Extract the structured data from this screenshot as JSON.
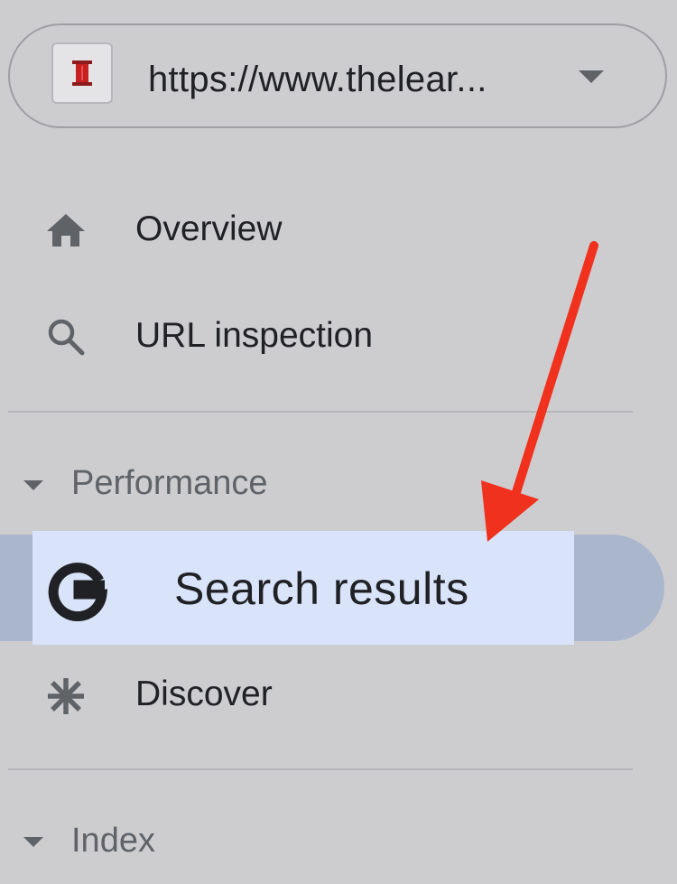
{
  "property_selector": {
    "url": "https://www.thelear...",
    "favicon": "red-spool-favicon",
    "dropdown_icon": "caret-down-icon"
  },
  "nav": {
    "overview": {
      "label": "Overview",
      "icon": "home-icon"
    },
    "url_inspection": {
      "label": "URL inspection",
      "icon": "search-icon"
    }
  },
  "sections": {
    "performance": {
      "label": "Performance",
      "items": {
        "search_results": {
          "label": "Search results",
          "icon": "google-g-icon",
          "active": true
        },
        "discover": {
          "label": "Discover",
          "icon": "asterisk-icon"
        }
      }
    },
    "index": {
      "label": "Index"
    }
  },
  "annotation": {
    "type": "red-arrow",
    "color": "#f0311e",
    "points_to": "Search results"
  },
  "colors": {
    "background": "#cdcdd0",
    "active_pill": "#a9b6cc",
    "highlight": "#d9e4fb",
    "arrow": "#f0311e"
  }
}
